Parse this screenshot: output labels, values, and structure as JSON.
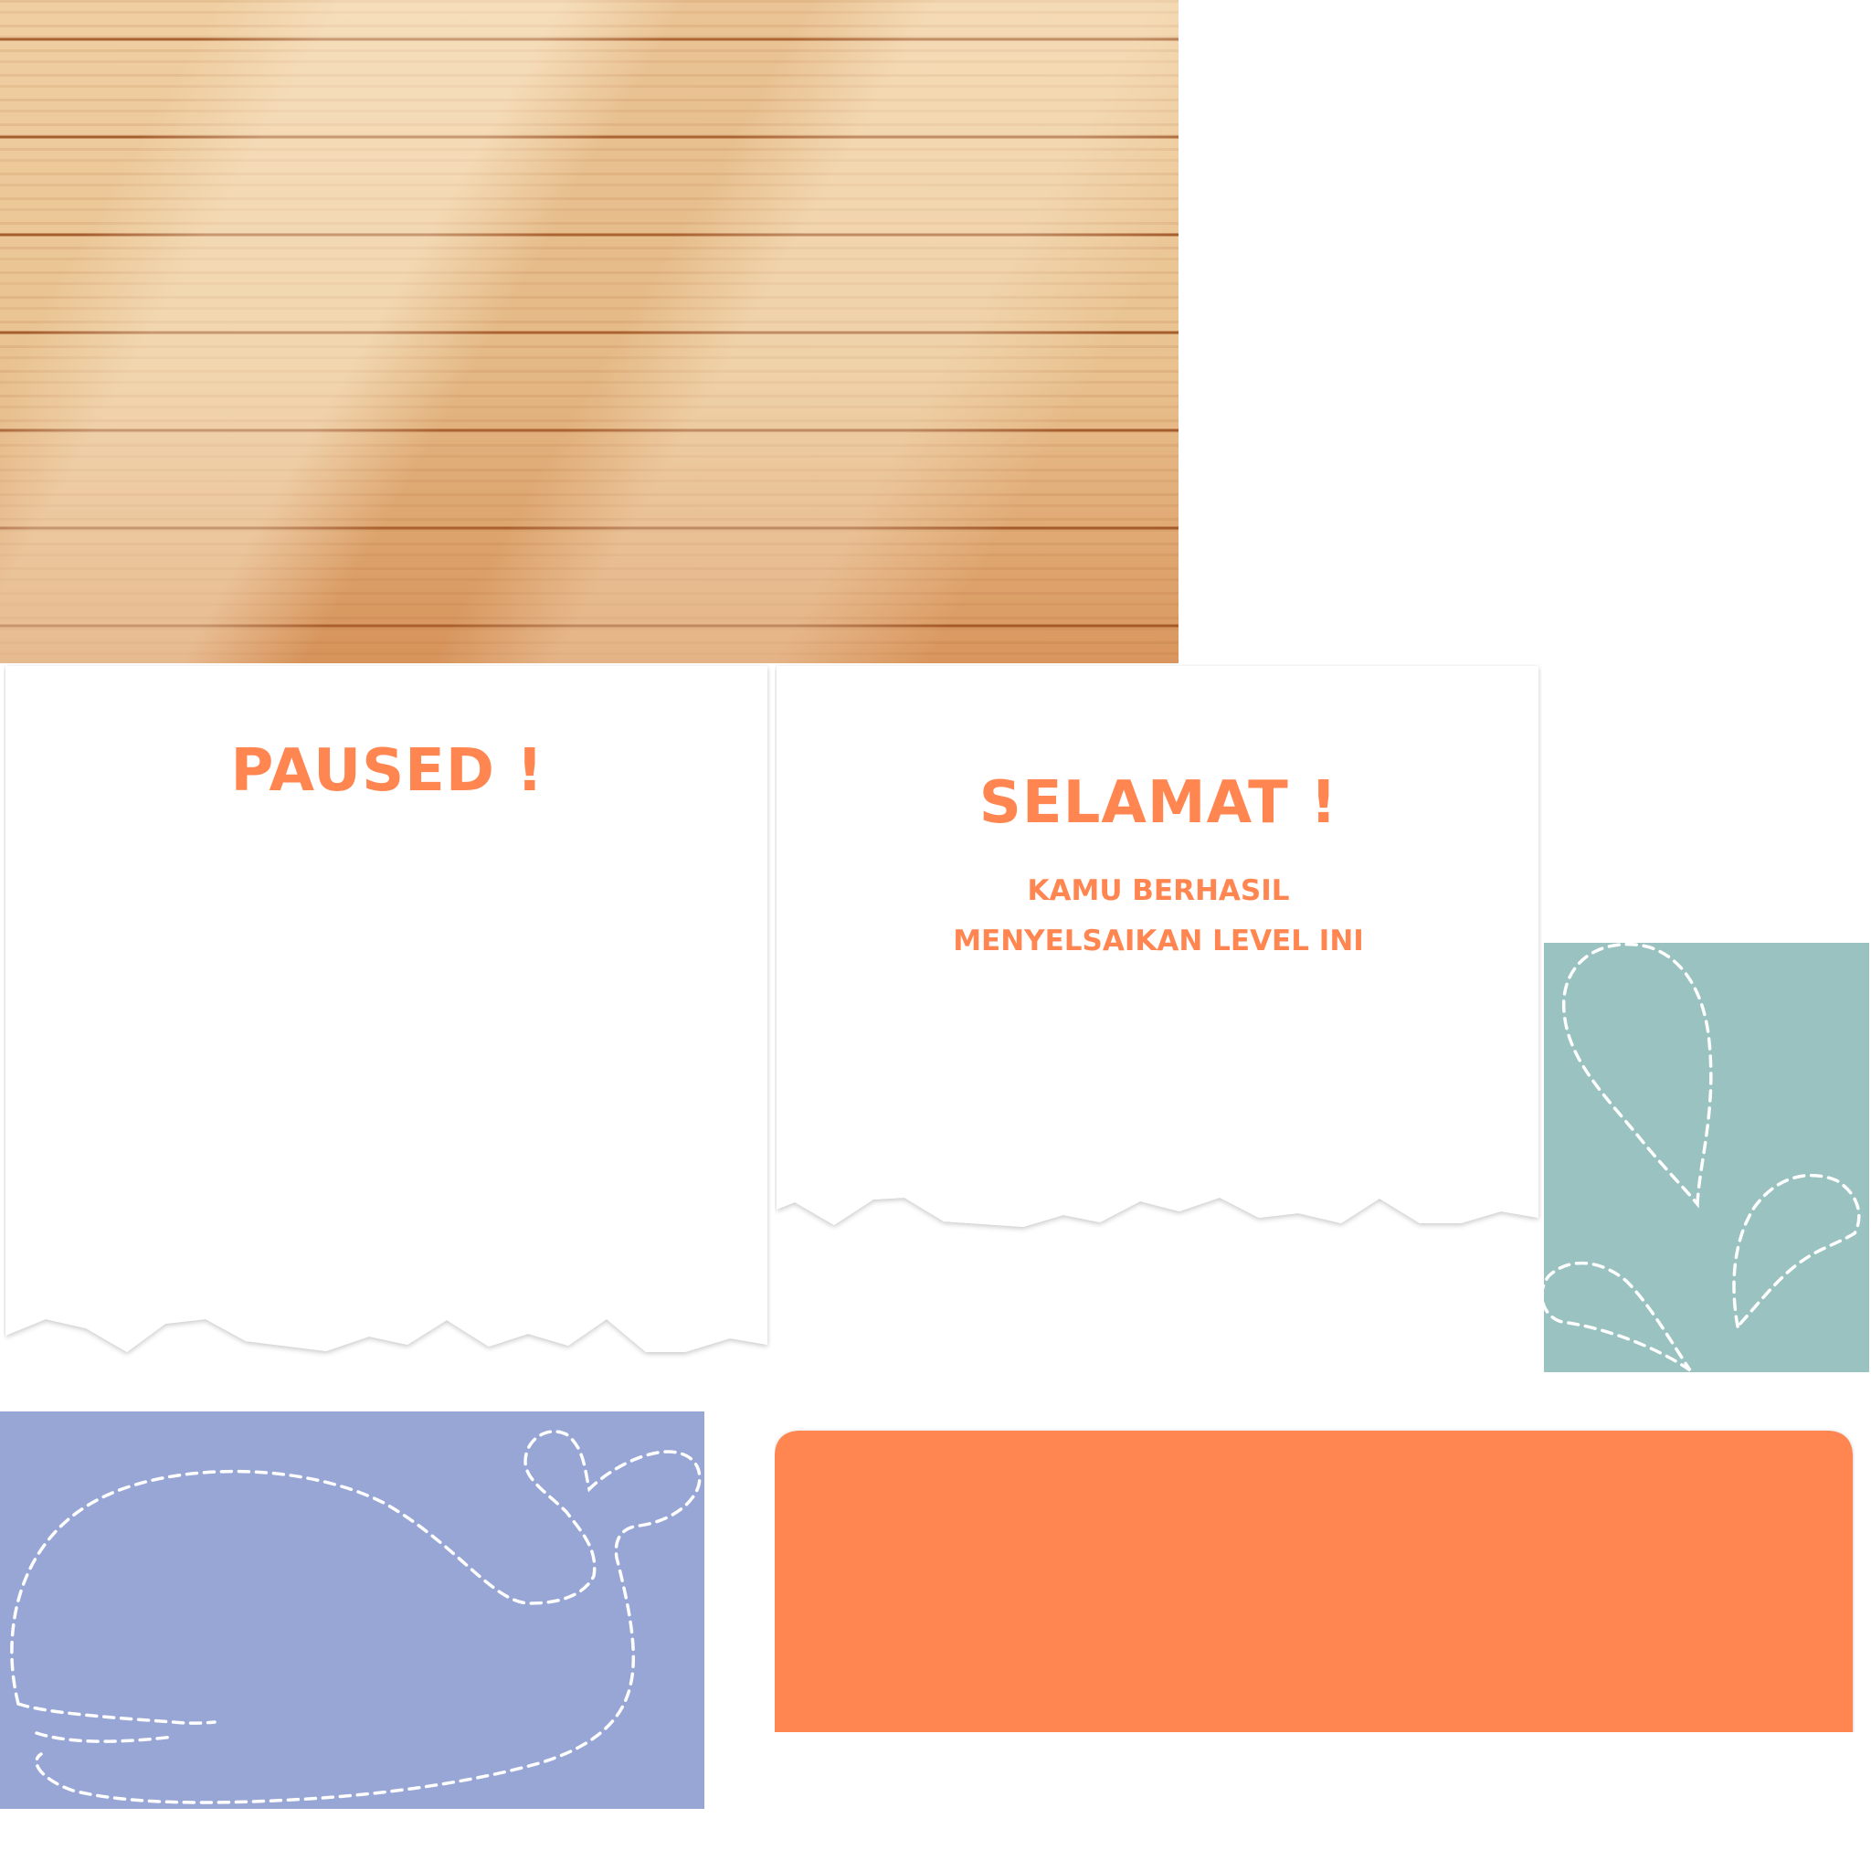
{
  "screen": {
    "name": "game-ui-asset-sheet",
    "background": "#ffffff"
  },
  "wood_background": {
    "colors": {
      "light": "#f0cfa3",
      "mid": "#e9c290",
      "dark": "#d9965e",
      "plank_line": "#9b4e1e"
    }
  },
  "paused_panel": {
    "title": "PAUSED !",
    "text_color": "#ff8651"
  },
  "win_panel": {
    "title": "SELAMAT !",
    "message_line1": "KAMU BERHASIL",
    "message_line2": "MENYELSAIKAN LEVEL INI",
    "text_color": "#ff8651"
  },
  "teal_tile": {
    "color": "#99c2c0",
    "icon": "dashed-droplet-splash-icon"
  },
  "blue_tile": {
    "color": "#97a6d5",
    "icon": "dashed-whale-icon"
  },
  "orange_plate": {
    "color": "#ff8651"
  }
}
